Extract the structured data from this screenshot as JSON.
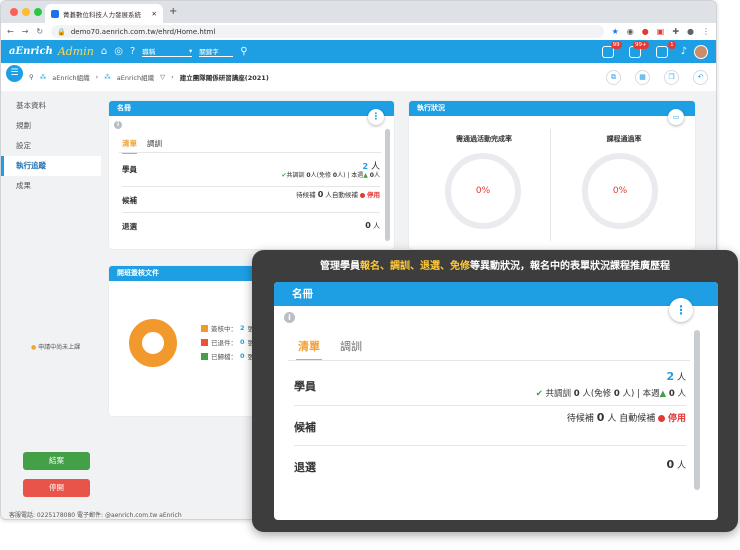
{
  "browser": {
    "tab_title": "菁碁數位科技人力發展系統",
    "new_tab": "+",
    "url": "demo70.aenrich.com.tw/ehrd/Home.html"
  },
  "navbar": {
    "logo": "aEnrich",
    "logo_suffix": "Admin",
    "select_label": "職稱",
    "keyword_placeholder": "關鍵字",
    "badges": [
      "99",
      "99+",
      "1"
    ]
  },
  "breadcrumb": {
    "items": [
      "aEnrich組織",
      "aEnrich組織",
      "建立團隊關係研習講座(2021)"
    ]
  },
  "sidebar": {
    "items": [
      "基本資料",
      "規劃",
      "設定",
      "執行追蹤",
      "成果"
    ],
    "note": "申請中尚未上課",
    "close_button": "結案",
    "stop_button": "停開"
  },
  "footer": {
    "text": "客服電話: 0225178080    電子郵件: @aenrich.com.tw    aEnrich"
  },
  "roster": {
    "title": "名冊",
    "tabs": [
      "清單",
      "調訓"
    ],
    "rows": [
      {
        "label": "學員",
        "num": "2",
        "unit": "人",
        "line2_prefix": "共調訓",
        "line2_a": "0",
        "line2_mid": "人(免修",
        "line2_b": "0",
        "line2_mid2": "人) | 本週",
        "line2_c": "0",
        "line2_unit": "人"
      },
      {
        "label": "候補",
        "waitlist_label": "待候補",
        "waitlist_num": "0",
        "unit": "人",
        "auto_label": "自動候補",
        "auto_status": "停用"
      },
      {
        "label": "退選",
        "num": "0",
        "unit": "人"
      }
    ]
  },
  "status_card": {
    "title": "執行狀況",
    "col1_title": "需通過活動完成率",
    "col1_value": "0%",
    "col2_title": "課程通過率",
    "col2_value": "0%"
  },
  "docs_card": {
    "title": "開班簽核文件",
    "legend": [
      {
        "label": "簽核中：",
        "value": "2",
        "unit": "張",
        "color": "#f2992e"
      },
      {
        "label": "已退件：",
        "value": "0",
        "unit": "張",
        "color": "#e8533a"
      },
      {
        "label": "已歸檔：",
        "value": "0",
        "unit": "張",
        "color": "#43a047"
      }
    ]
  },
  "callout": {
    "pre": "管理學員",
    "h1": "報名",
    "s1": "、",
    "h2": "調訓",
    "s2": "、",
    "h3": "退選",
    "s3": "、",
    "h4": "免修",
    "post": "等異動狀況，報名中的表單狀況課程推廣歷程"
  },
  "colors": {
    "brand": "#1e9fe3",
    "accent": "#f2a23a",
    "danger": "#e53935"
  }
}
